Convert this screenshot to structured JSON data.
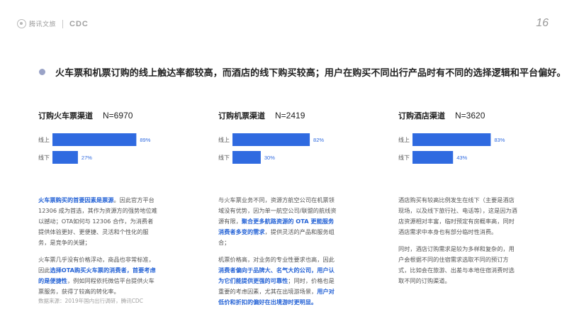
{
  "header": {
    "logo_text": "腾讯文旅",
    "logo_cdc": "CDC",
    "page_number": "16"
  },
  "headline": "火车票和机票订购的线上触达率都较高，而酒店的线下购买较高；用户在购买不同出行产品时有不同的选择逻辑和平台偏好。",
  "colors": {
    "bar": "#2f6ae0",
    "label": "#2f6ae0",
    "highlight": "#2563d6",
    "bullet": "#9aa3c7"
  },
  "chart_data": [
    {
      "type": "bar",
      "title": "订购火车票渠道",
      "n_label": "N=6970",
      "categories": [
        "线上",
        "线下"
      ],
      "values": [
        89,
        27
      ],
      "value_labels": [
        "89%",
        "27%"
      ],
      "xlim": [
        0,
        100
      ]
    },
    {
      "type": "bar",
      "title": "订购机票渠道",
      "n_label": "N=2419",
      "categories": [
        "线上",
        "线下"
      ],
      "values": [
        82,
        30
      ],
      "value_labels": [
        "82%",
        "30%"
      ],
      "xlim": [
        0,
        100
      ]
    },
    {
      "type": "bar",
      "title": "订购酒店渠道",
      "n_label": "N=3620",
      "categories": [
        "线上",
        "线下"
      ],
      "values": [
        83,
        43
      ],
      "value_labels": [
        "83%",
        "43%"
      ],
      "xlim": [
        0,
        100
      ]
    }
  ],
  "descriptions": [
    [
      [
        {
          "t": "火车票购买的首要因素是票源",
          "h": true
        },
        {
          "t": "。因此官方平台12306 成为首选，其作为资源方的强势地位难以撼动；OTA如何与 12306 合作，为消费者提供体验更好、更便捷、灵活和个性化的服务，是竞争的关键；",
          "h": false
        }
      ],
      [
        {
          "t": "火车票几乎没有价格浮动，商品也非常标准，因此",
          "h": false
        },
        {
          "t": "选择OTA购买火车票的消费者，首要考虑的是便捷性",
          "h": true
        },
        {
          "t": "，例如同程依托微信平台提供火车票服务，获得了较高的转化率。",
          "h": false
        }
      ]
    ],
    [
      [
        {
          "t": "与火车票业务不同，资源方航空公司在机票领域没有优势，因为单一航空公司/联盟的航线资源有限，",
          "h": false
        },
        {
          "t": "聚合更多航路资源的 OTA 更能服务消费者多变的需求",
          "h": true
        },
        {
          "t": "，提供灵活的产品和服务组合；",
          "h": false
        }
      ],
      [
        {
          "t": "机票价格高，对业务的专业性要求也高，因此",
          "h": false
        },
        {
          "t": "消费者偏向于品牌大、名气大的公司，用户认为它们能提供更强的可靠性",
          "h": true
        },
        {
          "t": "；同时，价格也是重要的考虑因素，尤其在出境游场景，",
          "h": false
        },
        {
          "t": "用户对低价和折扣的偏好在出境游时更明显。",
          "h": true
        }
      ]
    ],
    [
      [
        {
          "t": "酒店购买有较高比例发生在线下（主要是酒店现场，以及线下旅行社、电话等），这是因为酒店资源相对丰富，临时预定有房概率高，同时酒店需求中本身也有部分临时性消费。",
          "h": false
        }
      ],
      [
        {
          "t": "同时，酒店订购需求是较为多样和复杂的，用户会根据不同的住宿需求选取不同的预订方式，比如会在旅游、出差与本地住宿消费时选取不同的订购渠道。",
          "h": false
        }
      ]
    ]
  ],
  "source": "数据来源：2019年国内出行调研，腾讯CDC"
}
